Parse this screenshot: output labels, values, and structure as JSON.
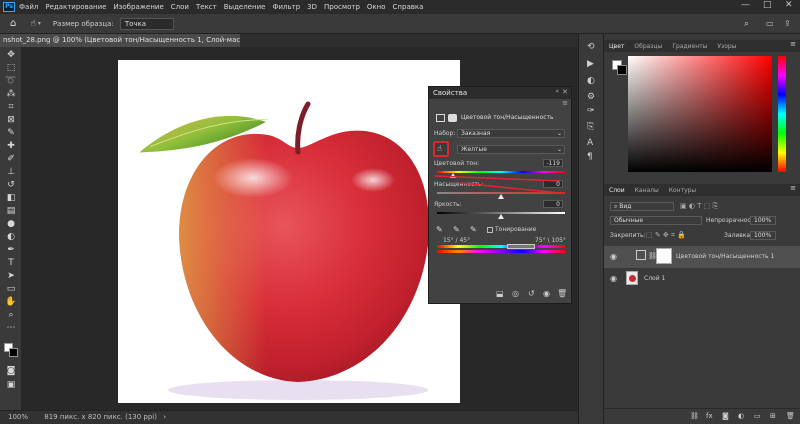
{
  "menubar": {
    "app_badge": "Ps",
    "items": [
      "Файл",
      "Редактирование",
      "Изображение",
      "Слои",
      "Текст",
      "Выделение",
      "Фильтр",
      "3D",
      "Просмотр",
      "Окно",
      "Справка"
    ],
    "window_controls": [
      "—",
      "□",
      "✕"
    ]
  },
  "options": {
    "sample_size_label": "Размер образца:",
    "sample_size_value": "Точка"
  },
  "document": {
    "tab_title": "nshot_28.png @ 100% (Цветовой тон/Насыщенность 1, Слой-маска/8) *",
    "tab_close": "×"
  },
  "status": {
    "zoom": "100%",
    "info": "819 пикс. x 820 пикс. (130 ppi)"
  },
  "properties": {
    "title": "Свойства",
    "layer_name": "Цветовой тон/Насыщенность",
    "preset_label": "Набор:",
    "preset_value": "Заказная",
    "channel_value": "Желтые",
    "hue_label": "Цветовой тон:",
    "hue_value": "-119",
    "saturation_label": "Насыщенность:",
    "saturation_value": "0",
    "lightness_label": "Яркость:",
    "lightness_value": "0",
    "colorize_label": "Тонирование",
    "range_left": "15° / 45°",
    "range_right": "75° \\ 105°"
  },
  "color_panel": {
    "tabs": [
      "Цвет",
      "Образцы",
      "Градиенты",
      "Узоры"
    ],
    "active_tab": 0,
    "base_hue": "#ff0000"
  },
  "layers_panel": {
    "tabs": [
      "Слои",
      "Каналы",
      "Контуры"
    ],
    "filter_value": "Вид",
    "blend_mode": "Обычные",
    "opacity_label": "Непрозрачность:",
    "opacity_value": "100%",
    "lock_label": "Закрепить:",
    "fill_label": "Заливка:",
    "fill_value": "100%",
    "layers": [
      {
        "name": "Цветовой тон/Насыщенность 1",
        "type": "adjustment"
      },
      {
        "name": "Слой 1",
        "type": "pixel"
      }
    ],
    "footer_icons": [
      "ссылка",
      "fx",
      "маска",
      "коррекция",
      "группа",
      "новый слой",
      "удалить"
    ]
  },
  "colors": {
    "accent": "#31a8ff",
    "annotation_red": "#e0262a"
  }
}
